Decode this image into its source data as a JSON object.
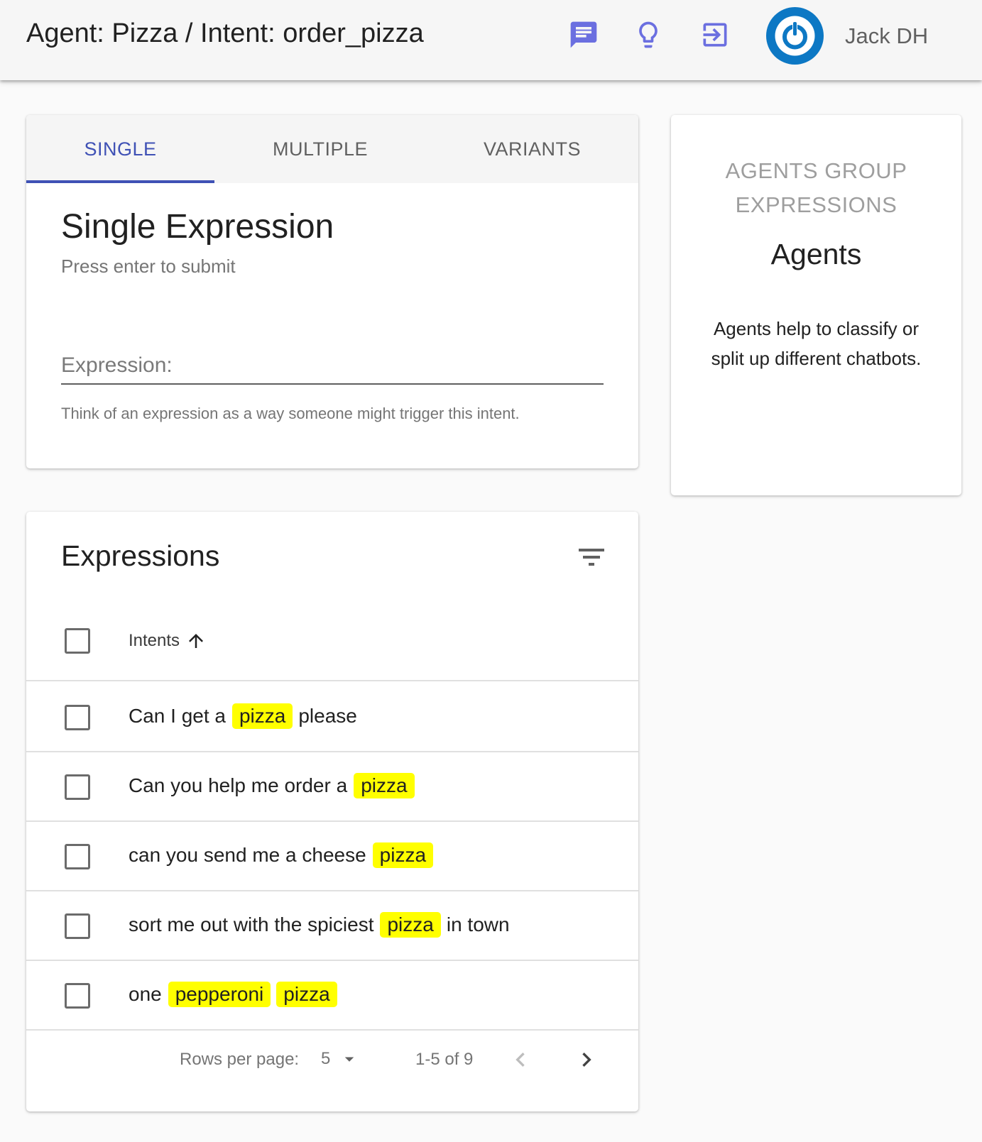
{
  "header": {
    "title": "Agent: Pizza / Intent: order_pizza",
    "icons": [
      "chat-icon",
      "lightbulb-icon",
      "login-icon"
    ],
    "username": "Jack DH",
    "icon_color": "#6b6fe0",
    "avatar_color": "#0d78c4"
  },
  "tabs": [
    {
      "label": "SINGLE",
      "active": true
    },
    {
      "label": "MULTIPLE",
      "active": false
    },
    {
      "label": "VARIANTS",
      "active": false
    }
  ],
  "single": {
    "title": "Single Expression",
    "subtitle": "Press enter to submit",
    "input_placeholder": "Expression:",
    "input_value": "",
    "helper": "Think of an expression as a way someone might trigger this intent."
  },
  "agents_card": {
    "heading_line1": "AGENTS GROUP",
    "heading_line2": "EXPRESSIONS",
    "title": "Agents",
    "body": "Agents help to classify or split up different chatbots."
  },
  "expressions": {
    "title": "Expressions",
    "column_header": "Intents",
    "sort": "ascending",
    "highlight_color": "#ffff00",
    "rows": [
      {
        "parts": [
          {
            "t": "Can I get a",
            "hl": false
          },
          {
            "t": "pizza",
            "hl": true
          },
          {
            "t": "please",
            "hl": false
          }
        ]
      },
      {
        "parts": [
          {
            "t": "Can you help me order a",
            "hl": false
          },
          {
            "t": "pizza",
            "hl": true
          }
        ]
      },
      {
        "parts": [
          {
            "t": "can you send me a cheese",
            "hl": false
          },
          {
            "t": "pizza",
            "hl": true
          }
        ]
      },
      {
        "parts": [
          {
            "t": "sort me out with the spiciest",
            "hl": false
          },
          {
            "t": "pizza",
            "hl": true
          },
          {
            "t": "in town",
            "hl": false
          }
        ]
      },
      {
        "parts": [
          {
            "t": "one",
            "hl": false
          },
          {
            "t": "pepperoni",
            "hl": true
          },
          {
            "t": "pizza",
            "hl": true
          }
        ]
      }
    ]
  },
  "pagination": {
    "rows_per_page_label": "Rows per page:",
    "rows_per_page_value": "5",
    "range_text": "1-5 of 9"
  },
  "colors": {
    "accent": "#3f51b5"
  }
}
